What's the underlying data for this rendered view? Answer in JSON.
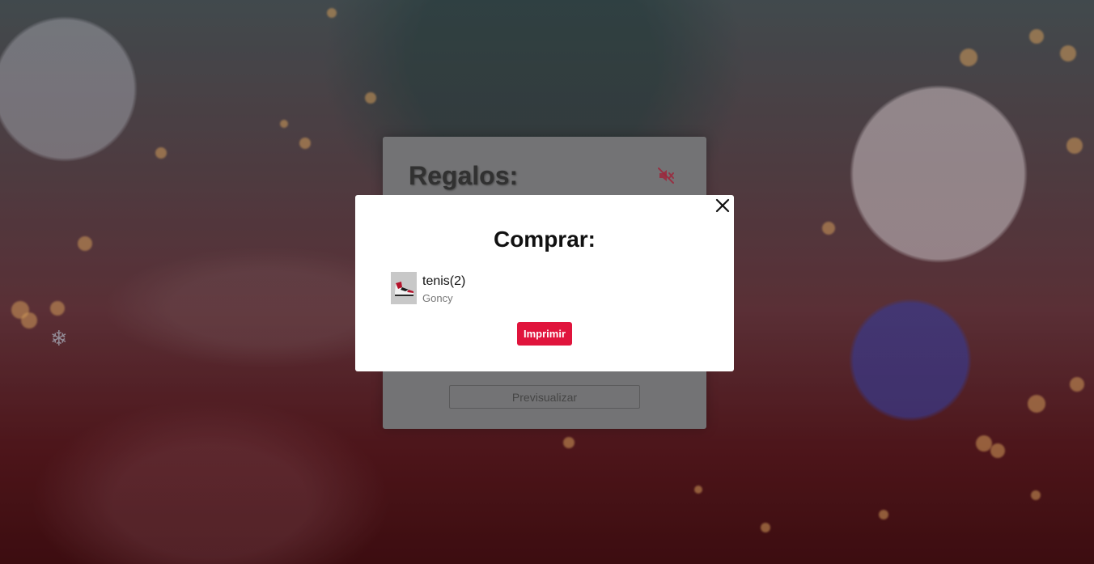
{
  "background_card": {
    "title": "Regalos:",
    "mute_icon": "volume-muted-icon",
    "preview_label": "Previsualizar"
  },
  "modal": {
    "title": "Comprar:",
    "close_icon": "close-icon",
    "items": [
      {
        "name": "tenis(2)",
        "recipient": "Goncy",
        "image": "sneaker-thumbnail"
      }
    ],
    "print_label": "Imprimir"
  },
  "colors": {
    "accent": "#e0143c",
    "mute_icon": "#c0304a"
  }
}
